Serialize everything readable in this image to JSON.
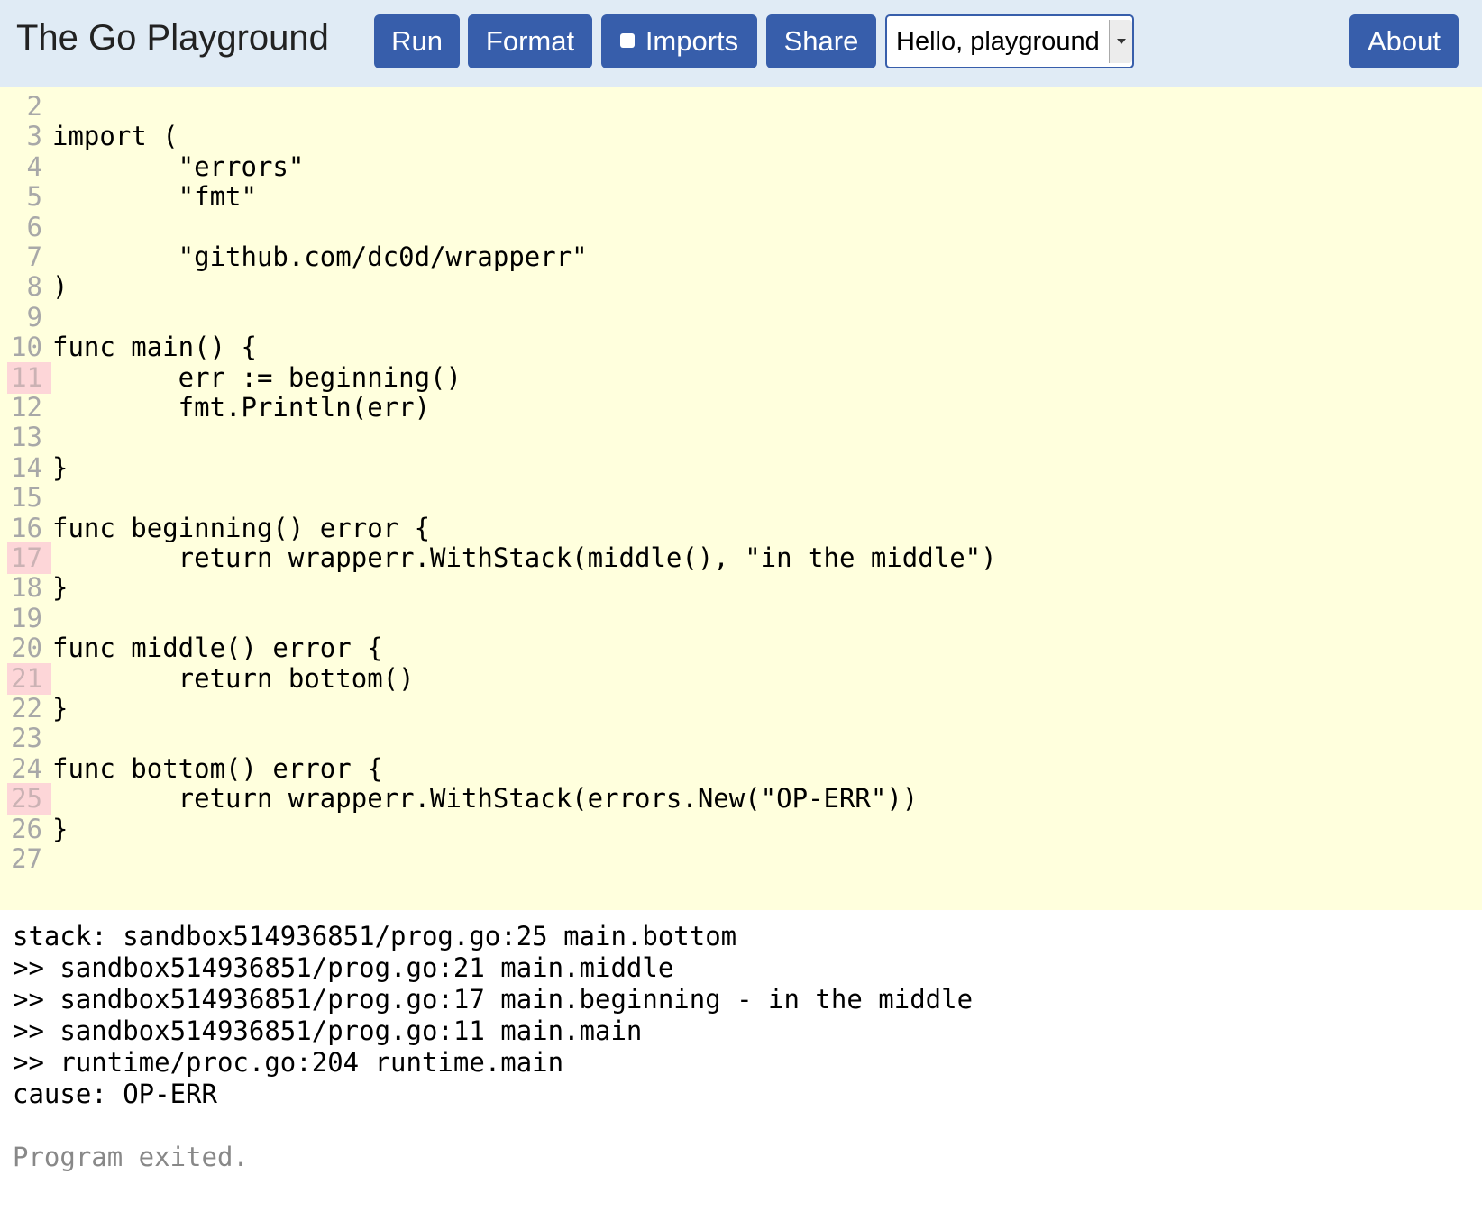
{
  "header": {
    "title": "The Go Playground",
    "run_label": "Run",
    "format_label": "Format",
    "imports_label": "Imports",
    "share_label": "Share",
    "example_selected": "Hello, playground",
    "about_label": "About"
  },
  "editor": {
    "lines": [
      {
        "n": "2",
        "text": "",
        "error": false
      },
      {
        "n": "3",
        "text": "import (",
        "error": false
      },
      {
        "n": "4",
        "text": "        \"errors\"",
        "error": false
      },
      {
        "n": "5",
        "text": "        \"fmt\"",
        "error": false
      },
      {
        "n": "6",
        "text": "",
        "error": false
      },
      {
        "n": "7",
        "text": "        \"github.com/dc0d/wrapperr\"",
        "error": false
      },
      {
        "n": "8",
        "text": ")",
        "error": false
      },
      {
        "n": "9",
        "text": "",
        "error": false
      },
      {
        "n": "10",
        "text": "func main() {",
        "error": false
      },
      {
        "n": "11",
        "text": "        err := beginning()",
        "error": true
      },
      {
        "n": "12",
        "text": "        fmt.Println(err)",
        "error": false
      },
      {
        "n": "13",
        "text": "",
        "error": false
      },
      {
        "n": "14",
        "text": "}",
        "error": false
      },
      {
        "n": "15",
        "text": "",
        "error": false
      },
      {
        "n": "16",
        "text": "func beginning() error {",
        "error": false
      },
      {
        "n": "17",
        "text": "        return wrapperr.WithStack(middle(), \"in the middle\")",
        "error": true
      },
      {
        "n": "18",
        "text": "}",
        "error": false
      },
      {
        "n": "19",
        "text": "",
        "error": false
      },
      {
        "n": "20",
        "text": "func middle() error {",
        "error": false
      },
      {
        "n": "21",
        "text": "        return bottom()",
        "error": true
      },
      {
        "n": "22",
        "text": "}",
        "error": false
      },
      {
        "n": "23",
        "text": "",
        "error": false
      },
      {
        "n": "24",
        "text": "func bottom() error {",
        "error": false
      },
      {
        "n": "25",
        "text": "        return wrapperr.WithStack(errors.New(\"OP-ERR\"))",
        "error": true
      },
      {
        "n": "26",
        "text": "}",
        "error": false
      },
      {
        "n": "27",
        "text": "",
        "error": false
      }
    ]
  },
  "output": {
    "lines": [
      "stack: sandbox514936851/prog.go:25 main.bottom",
      ">> sandbox514936851/prog.go:21 main.middle",
      ">> sandbox514936851/prog.go:17 main.beginning - in the middle",
      ">> sandbox514936851/prog.go:11 main.main",
      ">> runtime/proc.go:204 runtime.main",
      "cause: OP-ERR"
    ],
    "exit_message": "Program exited."
  },
  "colors": {
    "header_bg": "#e0ebf5",
    "button_bg": "#375eab",
    "editor_bg": "#ffffdd",
    "error_line_bg": "#fdd6d8"
  }
}
